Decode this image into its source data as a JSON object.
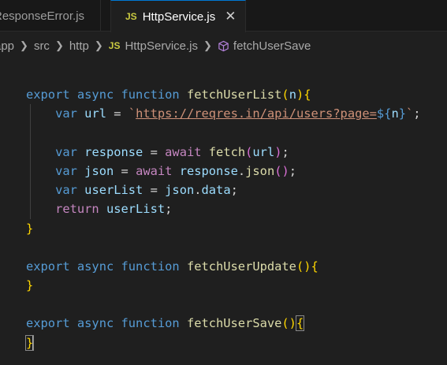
{
  "tabs": {
    "inactive_label": "ResponseError.js",
    "active_icon": "JS",
    "active_label": "HttpService.js",
    "close_glyph": "✕"
  },
  "breadcrumb": {
    "items": [
      "app",
      "src",
      "http"
    ],
    "file_icon": "JS",
    "file": "HttpService.js",
    "symbol": "fetchUserSave"
  },
  "code": {
    "l1_export": "export",
    "l1_async": "async",
    "l1_function": "function",
    "l1_name": "fetchUserList",
    "l1_paren_open": "(",
    "l1_param": "n",
    "l1_paren_close": ")",
    "l1_brace": "{",
    "l2_var": "var",
    "l2_name": "url",
    "l2_eq": "=",
    "l2_backtick_open": "`",
    "l2_url": "https://reqres.in/api/users?page=",
    "l2_tpl_open": "${",
    "l2_tpl_var": "n",
    "l2_tpl_close": "}",
    "l2_backtick_close": "`",
    "l2_semi": ";",
    "l4_var": "var",
    "l4_name": "response",
    "l4_eq": "=",
    "l4_await": "await",
    "l4_fn": "fetch",
    "l4_paren_open": "(",
    "l4_arg": "url",
    "l4_paren_close": ")",
    "l4_semi": ";",
    "l5_var": "var",
    "l5_name": "json",
    "l5_eq": "=",
    "l5_await": "await",
    "l5_obj": "response",
    "l5_dot": ".",
    "l5_method": "json",
    "l5_parens": "()",
    "l5_semi": ";",
    "l6_var": "var",
    "l6_name": "userList",
    "l6_eq": "=",
    "l6_obj": "json",
    "l6_dot": ".",
    "l6_prop": "data",
    "l6_semi": ";",
    "l7_return": "return",
    "l7_value": "userList",
    "l7_semi": ";",
    "l8_brace": "}",
    "l10_export": "export",
    "l10_async": "async",
    "l10_function": "function",
    "l10_name": "fetchUserUpdate",
    "l10_parens": "()",
    "l10_brace": "{",
    "l11_brace": "}",
    "l13_export": "export",
    "l13_async": "async",
    "l13_function": "function",
    "l13_name": "fetchUserSave",
    "l13_parens": "()",
    "l13_brace": "{",
    "l14_brace": "}"
  },
  "colors": {
    "background": "#1f1f1f",
    "keyword": "#569cd6",
    "control": "#c586c0",
    "function": "#dcdcaa",
    "variable": "#9cdcfe",
    "string": "#ce9178",
    "bracket": "#ffd700",
    "active_tab_accent": "#0078d4"
  }
}
